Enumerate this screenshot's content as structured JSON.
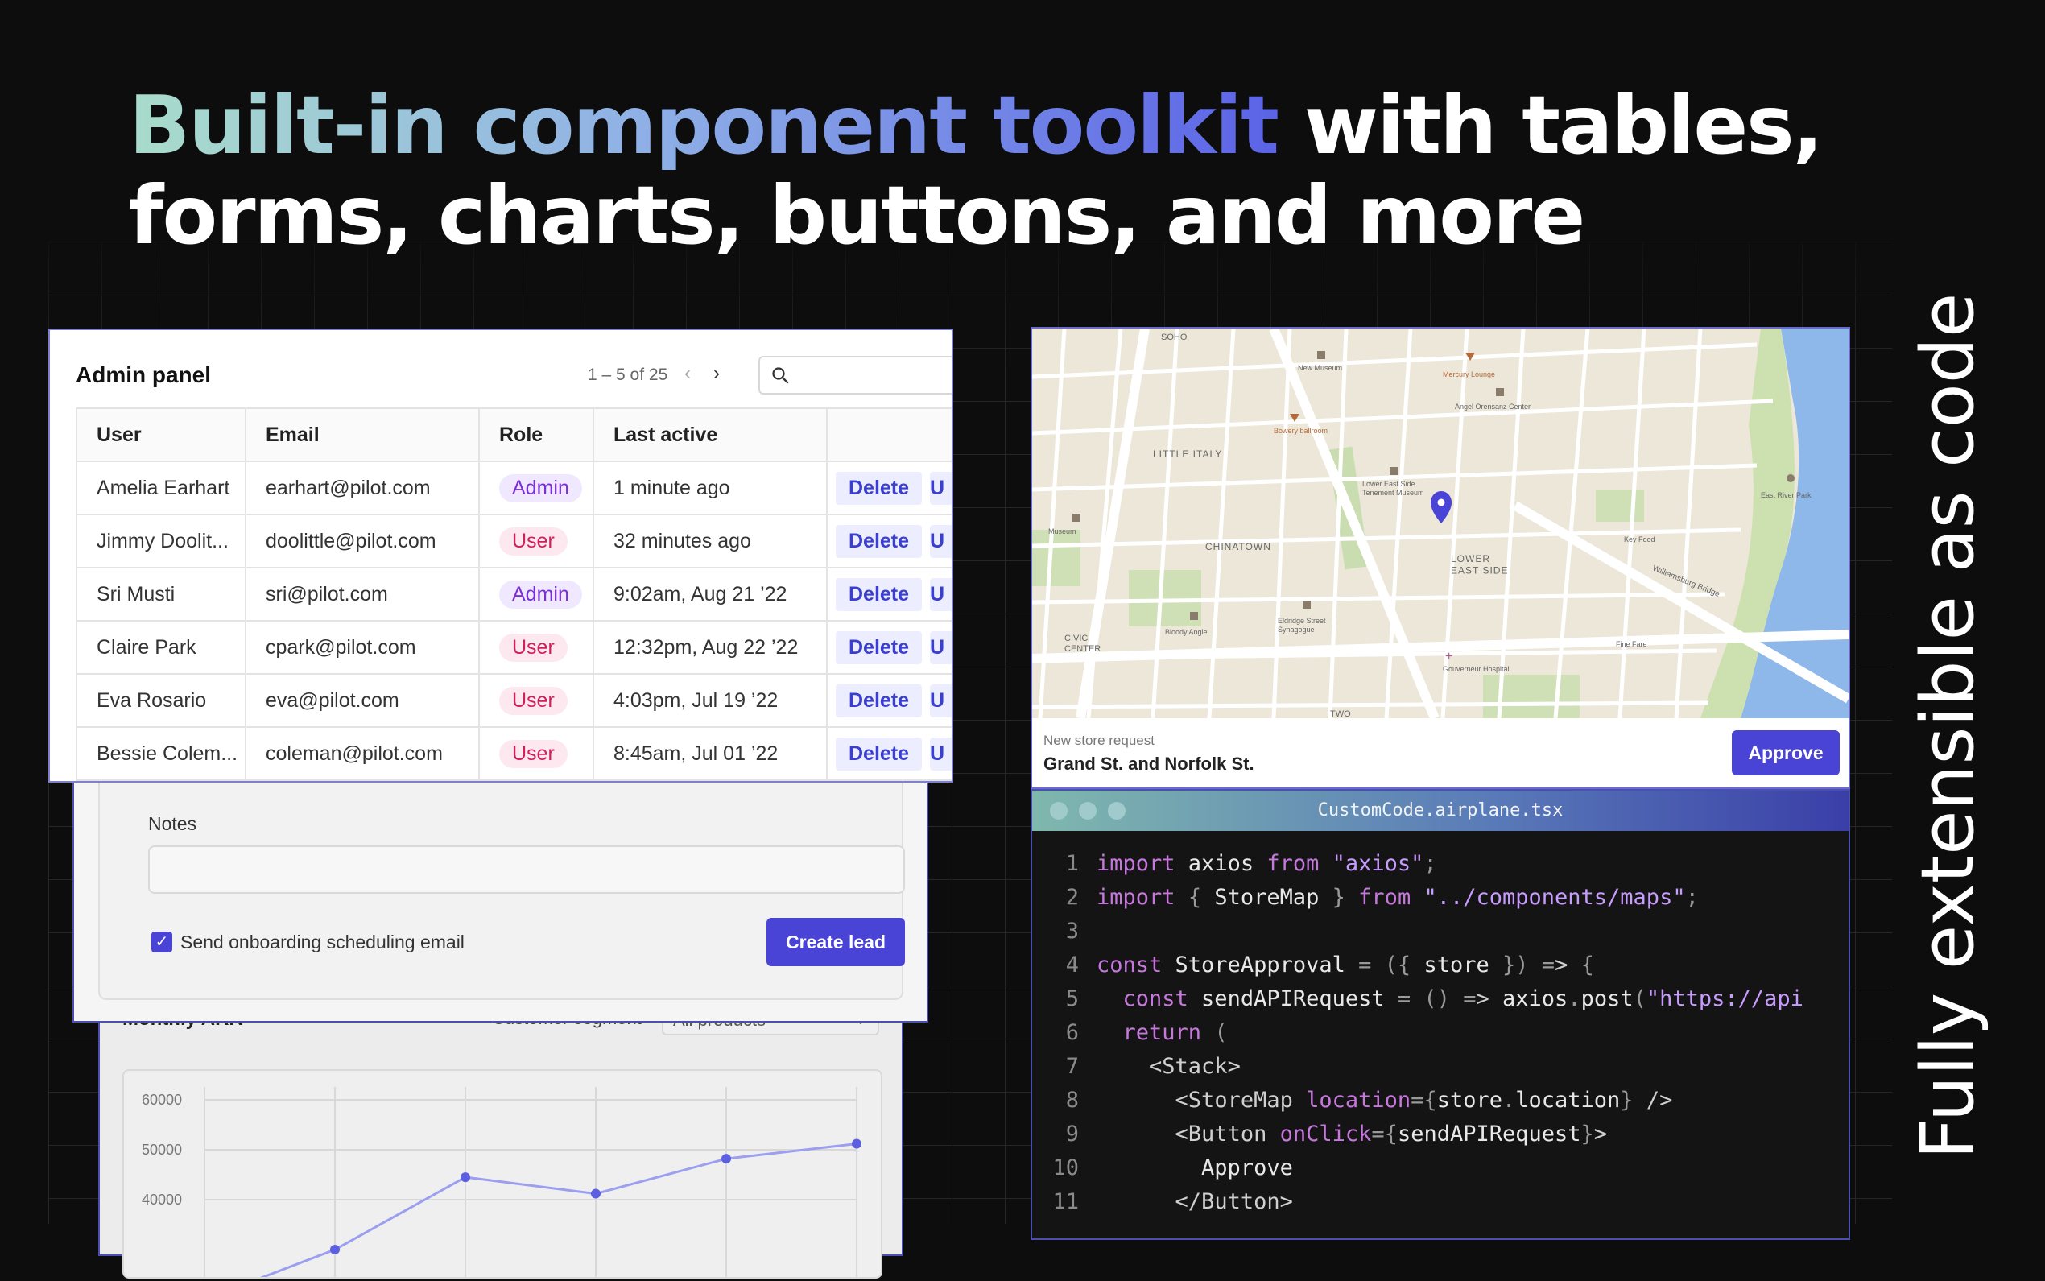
{
  "headline": {
    "highlight": "Built-in component toolkit",
    "rest": " with tables, forms, charts, buttons, and more"
  },
  "side_tagline": "Fully extensible as code",
  "admin_panel": {
    "title": "Admin panel",
    "pagination": "1 – 5 of 25",
    "columns": [
      "User",
      "Email",
      "Role",
      "Last active",
      ""
    ],
    "rows": [
      {
        "user": "Amelia Earhart",
        "email": "earhart@pilot.com",
        "role": "Admin",
        "last_active": "1 minute ago",
        "action": "Delete"
      },
      {
        "user": "Jimmy Doolit...",
        "email": "doolittle@pilot.com",
        "role": "User",
        "last_active": "32 minutes ago",
        "action": "Delete"
      },
      {
        "user": "Sri Musti",
        "email": "sri@pilot.com",
        "role": "Admin",
        "last_active": "9:02am, Aug 21 ’22",
        "action": "Delete"
      },
      {
        "user": "Claire Park",
        "email": "cpark@pilot.com",
        "role": "User",
        "last_active": "12:32pm, Aug 22 ’22",
        "action": "Delete"
      },
      {
        "user": "Eva Rosario",
        "email": "eva@pilot.com",
        "role": "User",
        "last_active": "4:03pm, Jul 19 ’22",
        "action": "Delete"
      },
      {
        "user": "Bessie Colem...",
        "email": "coleman@pilot.com",
        "role": "User",
        "last_active": "8:45am, Jul 01 ’22",
        "action": "Delete"
      }
    ],
    "more_action_label": "U"
  },
  "form": {
    "notes_label": "Notes",
    "notes_value": "",
    "checkbox_label": "Send onboarding scheduling email",
    "checkbox_checked": true,
    "submit_label": "Create lead"
  },
  "chart_card": {
    "title": "Monthly ARR",
    "segment_label": "Customer segment",
    "segment_value": "All products"
  },
  "chart_data": {
    "type": "line",
    "title": "Monthly ARR",
    "xlabel": "",
    "ylabel": "",
    "y_ticks": [
      "60000",
      "50000",
      "40000"
    ],
    "ylim": [
      30000,
      65000
    ],
    "series": [
      {
        "values": [
          20000,
          30000,
          44500,
          41200,
          48200,
          51200
        ]
      }
    ],
    "color": "#5b5fe0",
    "grid": true
  },
  "map": {
    "labels": {
      "soho": "SOHO",
      "little_italy": "LITTLE ITALY",
      "chinatown": "CHINATOWN",
      "civic_center": "CIVIC\nCENTER",
      "lower_east_side": "LOWER\nEAST SIDE",
      "new_museum": "New Museum",
      "mercury_lounge": "Mercury Lounge",
      "angel_orensanz": "Angel Orensanz Center",
      "bowery_ballroom": "Bowery ballroom",
      "tenement_museum": "Lower East Side\nTenement Museum",
      "museum": "Museum",
      "east_river_park": "East River Park",
      "key_food": "Key Food",
      "williamsburg_bridge": "Williamsburg Bridge",
      "bloody_angle": "Bloody Angle",
      "eldridge_synagogue": "Eldridge Street\nSynagogue",
      "gouverneur_hospital": "Gouverneur Hospital",
      "fine_fare": "Fine Fare",
      "two": "TWO"
    },
    "request_label": "New store request",
    "request_address": "Grand St. and Norfolk St.",
    "approve_label": "Approve"
  },
  "code_editor": {
    "filename": "CustomCode.airplane.tsx",
    "lines": [
      "import axios from \"axios\";",
      "import { StoreMap } from \"../components/maps\";",
      "",
      "const StoreApproval = ({ store }) => {",
      "  const sendAPIRequest = () => axios.post(\"https://api",
      "  return (",
      "    <Stack>",
      "      <StoreMap location={store.location} />",
      "      <Button onClick={sendAPIRequest}>",
      "        Approve",
      "      </Button>"
    ]
  },
  "colors": {
    "accent": "#4a44d6",
    "background": "#0d0d0d",
    "admin_badge": "#7a2fd9",
    "user_badge": "#d0205a"
  }
}
